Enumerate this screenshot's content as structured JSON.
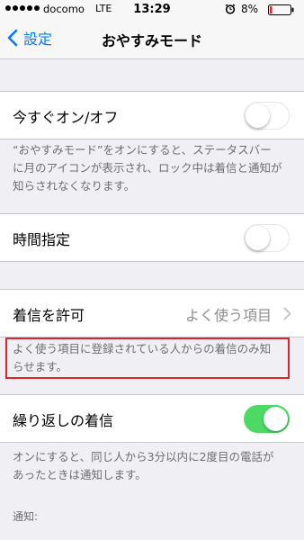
{
  "status_bar": {
    "carrier": "docomo",
    "network": "LTE",
    "time": "13:29",
    "battery": "8%"
  },
  "nav": {
    "back_label": "設定",
    "title": "おやすみモード"
  },
  "manual": {
    "label": "今すぐオン/オフ",
    "enabled": false,
    "footer": "“おやすみモード”をオンにすると、ステータスバーに月のアイコンが表示され、ロック中は着信と通知が知らされなくなります。"
  },
  "scheduled": {
    "label": "時間指定",
    "enabled": false
  },
  "allow_calls": {
    "label": "着信を許可",
    "value": "よく使う項目",
    "footer": "よく使う項目に登録されている人からの着信のみ知らせます。"
  },
  "repeated_calls": {
    "label": "繰り返しの着信",
    "enabled": true,
    "footer": "オンにすると、同じ人から3分以内に2度目の電話があったときは通知します。"
  },
  "silence_header": "通知:",
  "colors": {
    "accent": "#007aff",
    "toggle_on": "#4cd964",
    "highlight": "#d9252b",
    "background": "#efeff4"
  },
  "icons": {
    "alarm": "alarm-clock-icon",
    "battery": "battery-icon",
    "back": "chevron-left-icon",
    "disclosure": "chevron-right-icon"
  }
}
